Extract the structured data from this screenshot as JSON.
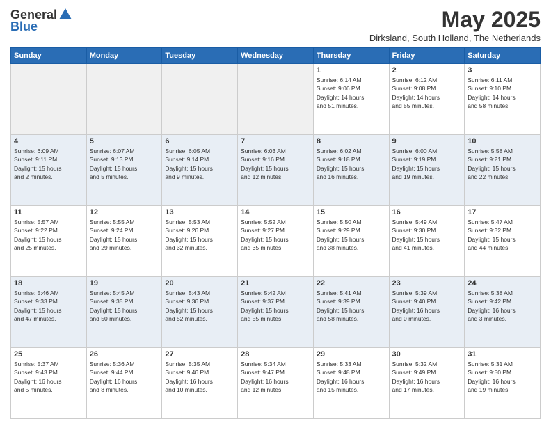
{
  "logo": {
    "general": "General",
    "blue": "Blue"
  },
  "title": "May 2025",
  "location": "Dirksland, South Holland, The Netherlands",
  "headers": [
    "Sunday",
    "Monday",
    "Tuesday",
    "Wednesday",
    "Thursday",
    "Friday",
    "Saturday"
  ],
  "weeks": [
    [
      {
        "day": "",
        "info": ""
      },
      {
        "day": "",
        "info": ""
      },
      {
        "day": "",
        "info": ""
      },
      {
        "day": "",
        "info": ""
      },
      {
        "day": "1",
        "info": "Sunrise: 6:14 AM\nSunset: 9:06 PM\nDaylight: 14 hours\nand 51 minutes."
      },
      {
        "day": "2",
        "info": "Sunrise: 6:12 AM\nSunset: 9:08 PM\nDaylight: 14 hours\nand 55 minutes."
      },
      {
        "day": "3",
        "info": "Sunrise: 6:11 AM\nSunset: 9:10 PM\nDaylight: 14 hours\nand 58 minutes."
      }
    ],
    [
      {
        "day": "4",
        "info": "Sunrise: 6:09 AM\nSunset: 9:11 PM\nDaylight: 15 hours\nand 2 minutes."
      },
      {
        "day": "5",
        "info": "Sunrise: 6:07 AM\nSunset: 9:13 PM\nDaylight: 15 hours\nand 5 minutes."
      },
      {
        "day": "6",
        "info": "Sunrise: 6:05 AM\nSunset: 9:14 PM\nDaylight: 15 hours\nand 9 minutes."
      },
      {
        "day": "7",
        "info": "Sunrise: 6:03 AM\nSunset: 9:16 PM\nDaylight: 15 hours\nand 12 minutes."
      },
      {
        "day": "8",
        "info": "Sunrise: 6:02 AM\nSunset: 9:18 PM\nDaylight: 15 hours\nand 16 minutes."
      },
      {
        "day": "9",
        "info": "Sunrise: 6:00 AM\nSunset: 9:19 PM\nDaylight: 15 hours\nand 19 minutes."
      },
      {
        "day": "10",
        "info": "Sunrise: 5:58 AM\nSunset: 9:21 PM\nDaylight: 15 hours\nand 22 minutes."
      }
    ],
    [
      {
        "day": "11",
        "info": "Sunrise: 5:57 AM\nSunset: 9:22 PM\nDaylight: 15 hours\nand 25 minutes."
      },
      {
        "day": "12",
        "info": "Sunrise: 5:55 AM\nSunset: 9:24 PM\nDaylight: 15 hours\nand 29 minutes."
      },
      {
        "day": "13",
        "info": "Sunrise: 5:53 AM\nSunset: 9:26 PM\nDaylight: 15 hours\nand 32 minutes."
      },
      {
        "day": "14",
        "info": "Sunrise: 5:52 AM\nSunset: 9:27 PM\nDaylight: 15 hours\nand 35 minutes."
      },
      {
        "day": "15",
        "info": "Sunrise: 5:50 AM\nSunset: 9:29 PM\nDaylight: 15 hours\nand 38 minutes."
      },
      {
        "day": "16",
        "info": "Sunrise: 5:49 AM\nSunset: 9:30 PM\nDaylight: 15 hours\nand 41 minutes."
      },
      {
        "day": "17",
        "info": "Sunrise: 5:47 AM\nSunset: 9:32 PM\nDaylight: 15 hours\nand 44 minutes."
      }
    ],
    [
      {
        "day": "18",
        "info": "Sunrise: 5:46 AM\nSunset: 9:33 PM\nDaylight: 15 hours\nand 47 minutes."
      },
      {
        "day": "19",
        "info": "Sunrise: 5:45 AM\nSunset: 9:35 PM\nDaylight: 15 hours\nand 50 minutes."
      },
      {
        "day": "20",
        "info": "Sunrise: 5:43 AM\nSunset: 9:36 PM\nDaylight: 15 hours\nand 52 minutes."
      },
      {
        "day": "21",
        "info": "Sunrise: 5:42 AM\nSunset: 9:37 PM\nDaylight: 15 hours\nand 55 minutes."
      },
      {
        "day": "22",
        "info": "Sunrise: 5:41 AM\nSunset: 9:39 PM\nDaylight: 15 hours\nand 58 minutes."
      },
      {
        "day": "23",
        "info": "Sunrise: 5:39 AM\nSunset: 9:40 PM\nDaylight: 16 hours\nand 0 minutes."
      },
      {
        "day": "24",
        "info": "Sunrise: 5:38 AM\nSunset: 9:42 PM\nDaylight: 16 hours\nand 3 minutes."
      }
    ],
    [
      {
        "day": "25",
        "info": "Sunrise: 5:37 AM\nSunset: 9:43 PM\nDaylight: 16 hours\nand 5 minutes."
      },
      {
        "day": "26",
        "info": "Sunrise: 5:36 AM\nSunset: 9:44 PM\nDaylight: 16 hours\nand 8 minutes."
      },
      {
        "day": "27",
        "info": "Sunrise: 5:35 AM\nSunset: 9:46 PM\nDaylight: 16 hours\nand 10 minutes."
      },
      {
        "day": "28",
        "info": "Sunrise: 5:34 AM\nSunset: 9:47 PM\nDaylight: 16 hours\nand 12 minutes."
      },
      {
        "day": "29",
        "info": "Sunrise: 5:33 AM\nSunset: 9:48 PM\nDaylight: 16 hours\nand 15 minutes."
      },
      {
        "day": "30",
        "info": "Sunrise: 5:32 AM\nSunset: 9:49 PM\nDaylight: 16 hours\nand 17 minutes."
      },
      {
        "day": "31",
        "info": "Sunrise: 5:31 AM\nSunset: 9:50 PM\nDaylight: 16 hours\nand 19 minutes."
      }
    ]
  ],
  "colors": {
    "header_bg": "#2a6db5",
    "header_text": "#ffffff",
    "row_odd": "#ffffff",
    "row_even": "#e8eef5",
    "empty_bg": "#f0f0f0"
  }
}
